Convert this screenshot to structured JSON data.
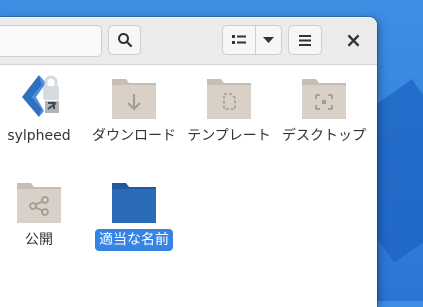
{
  "window": {
    "close_label": "×"
  },
  "toolbar": {
    "search_icon": "search-icon",
    "view_icon": "list-view-icon",
    "view_dropdown_icon": "chevron-down-icon",
    "menu_icon": "hamburger-menu-icon"
  },
  "files": [
    {
      "name": "sylpheed",
      "icon": "sylpheed-app-icon",
      "selected": false
    },
    {
      "name": "ダウンロード",
      "icon": "download-folder-icon",
      "selected": false
    },
    {
      "name": "テンプレート",
      "icon": "templates-folder-icon",
      "selected": false
    },
    {
      "name": "デスクトップ",
      "icon": "desktop-folder-icon",
      "selected": false
    },
    {
      "name": "公開",
      "icon": "public-share-folder-icon",
      "selected": false
    },
    {
      "name": "適当な名前",
      "icon": "folder-icon",
      "selected": true
    }
  ],
  "colors": {
    "accent": "#3584e4",
    "folder": "#d7cec6",
    "folder_selected": "#2a6bb8"
  }
}
